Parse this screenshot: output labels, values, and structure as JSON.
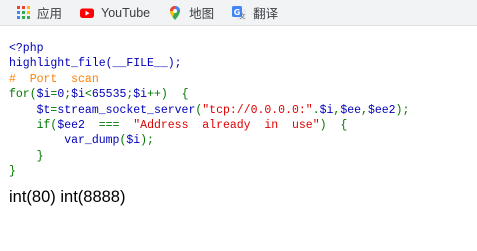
{
  "bookmarks_bar": {
    "items": [
      {
        "label": "应用",
        "icon": "apps-grid-icon"
      },
      {
        "label": "YouTube",
        "icon": "youtube-icon"
      },
      {
        "label": "地图",
        "icon": "maps-pin-icon"
      },
      {
        "label": "翻译",
        "icon": "translate-icon"
      }
    ]
  },
  "code": {
    "line1": "<?php",
    "line2": "highlight_file(__FILE__);",
    "line3": "#  Port  scan",
    "line4": [
      "for(",
      "$i",
      "=",
      "0",
      ";",
      "$i",
      "<",
      "65535",
      ";",
      "$i",
      "++)  {"
    ],
    "line5": [
      "    ",
      "$t",
      "=",
      "stream_socket_server",
      "(",
      "\"tcp://0.0.0.0:\"",
      ".",
      "$i",
      ",",
      "$ee",
      ",",
      "$ee2",
      ");"
    ],
    "line6": [
      "    ",
      "if(",
      "$ee2  ",
      "===  ",
      "\"Address  already  in  use\"",
      ")  {"
    ],
    "line7": [
      "        ",
      "var_dump",
      "(",
      "$i",
      ");"
    ],
    "line8": "    }",
    "line9": "}"
  },
  "output": {
    "text": "int(80) int(8888)"
  },
  "colors": {
    "php_default": "#0000bb",
    "php_keyword": "#007700",
    "php_comment": "#ff8000",
    "php_string": "#dd0000"
  }
}
